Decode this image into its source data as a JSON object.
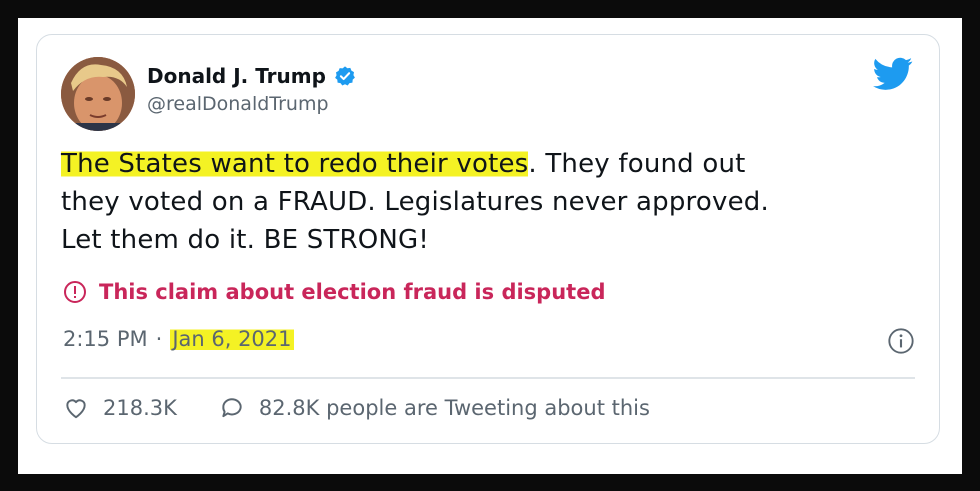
{
  "tweet": {
    "author": {
      "display_name": "Donald J. Trump",
      "handle": "@realDonaldTrump",
      "verified": true
    },
    "text": {
      "highlighted": "The States want to redo their votes",
      "rest_line1": ". They found out",
      "line2": "they voted on a FRAUD. Legislatures never approved.",
      "line3": "Let them do it. BE STRONG!"
    },
    "warning": {
      "label": "This claim about election fraud is disputed",
      "icon": "exclamation-circle-icon",
      "color": "#c9265a"
    },
    "meta": {
      "time": "2:15 PM",
      "separator": "·",
      "date": "Jan 6, 2021"
    },
    "stats": {
      "likes": "218.3K",
      "tweeting": "82.8K people are Tweeting about this"
    },
    "brand": {
      "icon": "twitter-bird-icon",
      "color": "#1d9bf0"
    },
    "highlight_color": "#f4f224"
  }
}
